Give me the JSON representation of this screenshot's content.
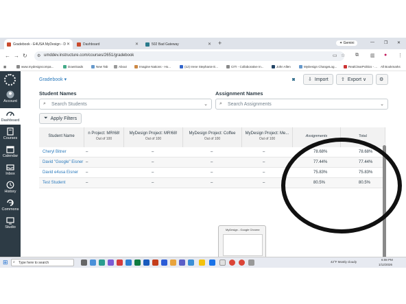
{
  "browser": {
    "tabs": [
      {
        "title": "Gradebook - E4USA MyDesign - D",
        "active": true
      },
      {
        "title": "Dashboard",
        "active": false
      },
      {
        "title": "502 Bad Gateway",
        "active": false
      }
    ],
    "gemini_label": "Gemini",
    "url": "umddev.instructure.com/courses/2651/gradebook",
    "bookmarks": [
      "www.mydesigncompa...",
      "Downloads",
      "New Tab",
      "About",
      "Imagine Nations - Ho...",
      "(12) Irene Stephanie E...",
      "CITI - Collaborative In...",
      "John Allen",
      "MyDesign ChangeLog...",
      "RealClearPolitics - ...",
      "All Bookmarks"
    ]
  },
  "sidebar": {
    "items": [
      {
        "label": "Account",
        "icon": "account-icon"
      },
      {
        "label": "Dashboard",
        "icon": "dashboard-icon",
        "active": true
      },
      {
        "label": "Courses",
        "icon": "courses-icon"
      },
      {
        "label": "Calendar",
        "icon": "calendar-icon"
      },
      {
        "label": "Inbox",
        "icon": "inbox-icon"
      },
      {
        "label": "History",
        "icon": "history-icon"
      },
      {
        "label": "Commons",
        "icon": "commons-icon"
      },
      {
        "label": "Studio",
        "icon": "studio-icon"
      }
    ]
  },
  "gradebook": {
    "title": "Gradebook ▾",
    "import_label": "Import",
    "export_label": "Export ∨",
    "student_names_label": "Student Names",
    "assignment_names_label": "Assignment Names",
    "search_students_placeholder": "Search Students",
    "search_assignments_placeholder": "Search Assignments",
    "apply_filters_label": "Apply Filters",
    "columns": [
      {
        "title": "Student Name",
        "sub": ""
      },
      {
        "title": "n Project: MR!68!",
        "sub": "Out of 100"
      },
      {
        "title": "MyDesign Project: MR!68!",
        "sub": "Out of 100"
      },
      {
        "title": "MyDesign Project: Coffee",
        "sub": "Out of 100"
      },
      {
        "title": "MyDesign Project: Me...",
        "sub": "Out of 100"
      },
      {
        "title": "Assignments",
        "sub": ""
      },
      {
        "title": "Total",
        "sub": ""
      }
    ],
    "rows": [
      {
        "name": "Cheryl Bitner",
        "c1": "–",
        "c2": "–",
        "c3": "–",
        "c4": "–",
        "assignments": "78.68%",
        "total": "78.68%"
      },
      {
        "name": "David \"Google\" Eisner",
        "c1": "–",
        "c2": "–",
        "c3": "–",
        "c4": "–",
        "assignments": "77.44%",
        "total": "77.44%"
      },
      {
        "name": "David e4usa Eisner",
        "c1": "–",
        "c2": "–",
        "c3": "–",
        "c4": "–",
        "assignments": "75.83%",
        "total": "75.83%"
      },
      {
        "name": "Test Student",
        "c1": "–",
        "c2": "–",
        "c3": "–",
        "c4": "–",
        "assignments": "80.5%",
        "total": "80.5%"
      }
    ]
  },
  "preview": {
    "title": "MyDesign - Google Chrome"
  },
  "taskbar": {
    "search_placeholder": "Type here to search",
    "weather": "42°F  Mostly cloudy",
    "time": "6:08 PM",
    "date": "1/12/2026"
  },
  "colors": {
    "nav_bg": "#2d3b45",
    "link": "#2b7abc",
    "annotation": "#111111"
  }
}
